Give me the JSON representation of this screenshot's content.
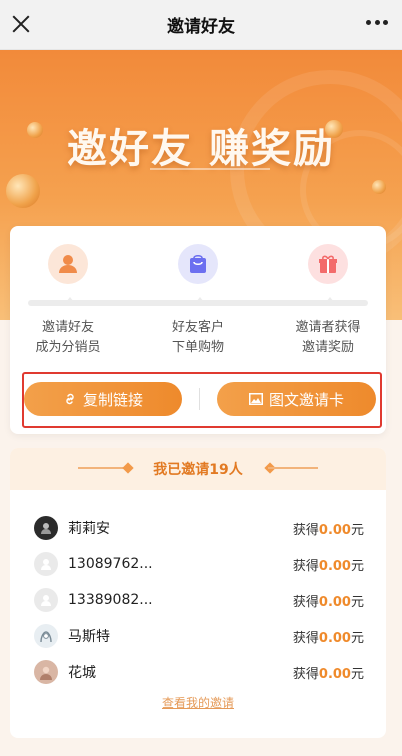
{
  "nav": {
    "title": "邀请好友"
  },
  "hero": {
    "headline": "邀好友  赚奖励"
  },
  "steps": [
    {
      "line1": "邀请好友",
      "line2": "成为分销员",
      "icon": "person-icon",
      "color": "#f08b4a"
    },
    {
      "line1": "好友客户",
      "line2": "下单购物",
      "icon": "shopping-bag-icon",
      "color": "#6c6ff0"
    },
    {
      "line1": "邀请者获得",
      "line2": "邀请奖励",
      "icon": "gift-icon",
      "color": "#f36b6b"
    }
  ],
  "actions": {
    "copy_link": "复制链接",
    "image_card": "图文邀请卡"
  },
  "invited": {
    "header": "我已邀请19人",
    "earn_prefix": "获得",
    "earn_suffix": "元",
    "rows": [
      {
        "name": "莉莉安",
        "amount": "0.00"
      },
      {
        "name": "13089762...",
        "amount": "0.00"
      },
      {
        "name": "13389082...",
        "amount": "0.00"
      },
      {
        "name": "马斯特",
        "amount": "0.00"
      },
      {
        "name": "花城",
        "amount": "0.00"
      }
    ],
    "more": "查看我的邀请"
  },
  "colors": {
    "accent": "#ef8a2b",
    "highlight_border": "#e03a30"
  }
}
